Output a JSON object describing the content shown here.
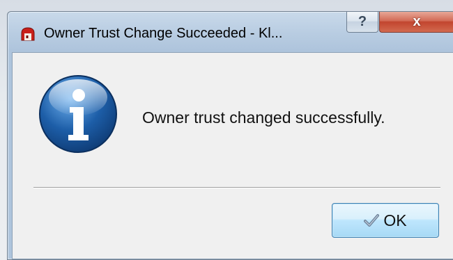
{
  "window": {
    "title": "Owner Trust Change Succeeded - Kl...",
    "help_glyph": "?",
    "close_glyph": "x"
  },
  "dialog": {
    "icon": "information-icon",
    "message": "Owner trust changed successfully.",
    "ok_label": "OK",
    "ok_icon": "checkmark-icon"
  },
  "colors": {
    "client_background": "#f0f0f0",
    "info_icon_blue": "#1d5ea8",
    "close_button_red": "#c2452f",
    "ok_button_blue": "#bee6fd",
    "app_icon_red": "#c8201a"
  }
}
